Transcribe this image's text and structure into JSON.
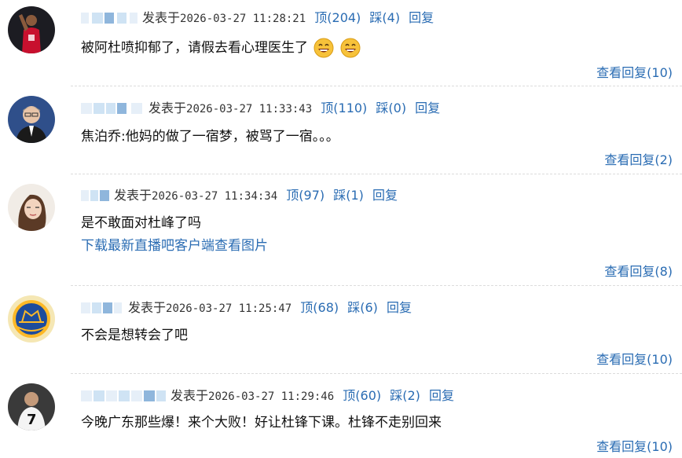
{
  "comments": [
    {
      "username": "",
      "posted_prefix": "发表于",
      "timestamp": "2026-03-27 11:28:21",
      "up_label": "顶(204)",
      "down_label": "踩(4)",
      "reply_label": "回复",
      "text": "被阿杜喷抑郁了，请假去看心理医生了",
      "emoji": [
        "grinning-face-icon",
        "grinning-face-icon"
      ],
      "view_replies_label": "查看回复(10)"
    },
    {
      "username": "",
      "posted_prefix": "发表于",
      "timestamp": "2026-03-27 11:33:43",
      "up_label": "顶(110)",
      "down_label": "踩(0)",
      "reply_label": "回复",
      "text": "焦泊乔:他妈的做了一宿梦，被骂了一宿。。。",
      "view_replies_label": "查看回复(2)"
    },
    {
      "username": "",
      "posted_prefix": "发表于",
      "timestamp": "2026-03-27 11:34:34",
      "up_label": "顶(97)",
      "down_label": "踩(1)",
      "reply_label": "回复",
      "text": "是不敢面对杜峰了吗",
      "download_link": "下载最新直播吧客户端查看图片",
      "view_replies_label": "查看回复(8)"
    },
    {
      "username": "",
      "posted_prefix": "发表于",
      "timestamp": "2026-03-27 11:25:47",
      "up_label": "顶(68)",
      "down_label": "踩(6)",
      "reply_label": "回复",
      "text": "不会是想转会了吧",
      "view_replies_label": "查看回复(10)"
    },
    {
      "username": "",
      "posted_prefix": "发表于",
      "timestamp": "2026-03-27 11:29:46",
      "up_label": "顶(60)",
      "down_label": "踩(2)",
      "reply_label": "回复",
      "text": "今晚广东那些爆！来个大败！好让杜锋下课。杜锋不走别回来",
      "view_replies_label": "查看回复(10)"
    }
  ],
  "colors": {
    "link": "#2a6cb3",
    "text": "#111111",
    "divider": "#dcdcdc",
    "redacted_name": "#cfe3f4"
  }
}
